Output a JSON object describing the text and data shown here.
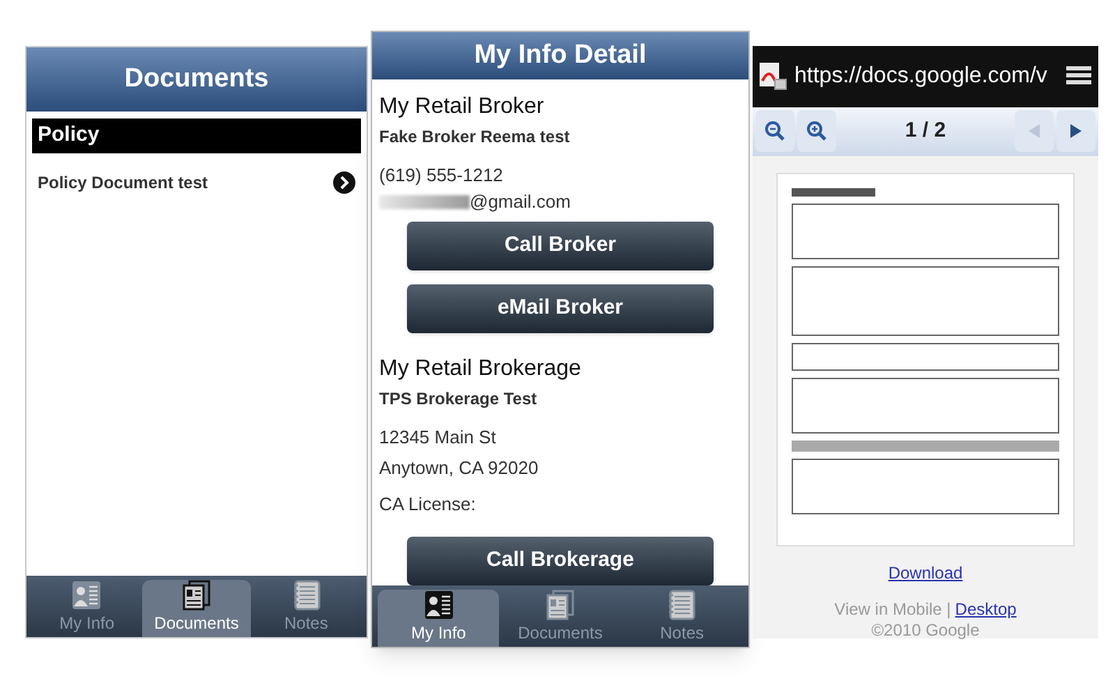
{
  "documents_screen": {
    "title": "Documents",
    "section_header": "Policy",
    "items": [
      {
        "label": "Policy Document test"
      }
    ],
    "tabs": [
      {
        "kind": "info",
        "label": "My Info",
        "selected": false
      },
      {
        "kind": "documents",
        "label": "Documents",
        "selected": true
      },
      {
        "kind": "notes",
        "label": "Notes",
        "selected": false
      }
    ]
  },
  "info_screen": {
    "title": "My Info Detail",
    "broker": {
      "heading": "My Retail Broker",
      "name": "Fake Broker Reema test",
      "phone": "(619) 555-1212",
      "email": "@gmail.com"
    },
    "broker_buttons": [
      "Call Broker",
      "eMail Broker"
    ],
    "brokerage": {
      "heading": "My Retail Brokerage",
      "name": "TPS Brokerage Test",
      "address_line_1": "12345 Main St",
      "address_line_2": "Anytown, CA 92020",
      "license": "CA License:"
    },
    "brokerage_buttons": [
      "Call Brokerage"
    ],
    "tabs": [
      {
        "kind": "info",
        "label": "My Info",
        "selected": true
      },
      {
        "kind": "documents",
        "label": "Documents",
        "selected": false
      },
      {
        "kind": "notes",
        "label": "Notes",
        "selected": false
      }
    ]
  },
  "pdf_viewer": {
    "url": "https://docs.google.com/v",
    "page_indicator": "1 / 2",
    "nav": [
      {
        "kind": "prev",
        "disabled": true
      },
      {
        "kind": "next",
        "disabled": false
      }
    ],
    "download_link": "Download",
    "view_text": "View in Mobile |",
    "desktop_link": "Desktop",
    "copyright": "©2010 Google"
  }
}
